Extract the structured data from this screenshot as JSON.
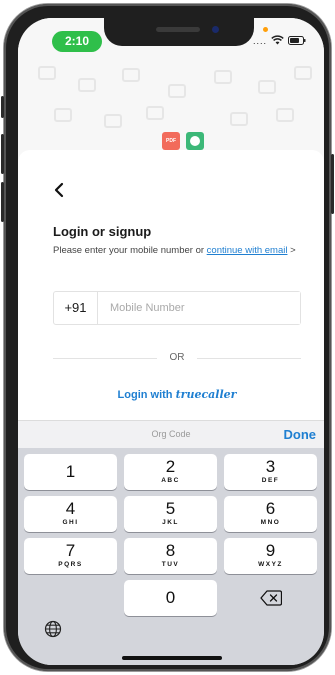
{
  "status_bar": {
    "time": "2:10",
    "signal": "....",
    "wifi_icon": "wifi-icon",
    "battery_icon": "battery-icon"
  },
  "background": {
    "pdf_badge": "PDF"
  },
  "login": {
    "title": "Login or signup",
    "subtitle_text": "Please enter your mobile number or ",
    "subtitle_link": "continue with email",
    "subtitle_suffix": " >",
    "country_code": "+91",
    "phone_placeholder": "Mobile Number",
    "or_label": "OR",
    "truecaller_prefix": "Login with ",
    "truecaller_brand": "truecaller"
  },
  "accessory_bar": {
    "field_hint": "Org Code",
    "done_label": "Done"
  },
  "keypad": {
    "keys": [
      {
        "num": "1",
        "letters": ""
      },
      {
        "num": "2",
        "letters": "ABC"
      },
      {
        "num": "3",
        "letters": "DEF"
      },
      {
        "num": "4",
        "letters": "GHI"
      },
      {
        "num": "5",
        "letters": "JKL"
      },
      {
        "num": "6",
        "letters": "MNO"
      },
      {
        "num": "7",
        "letters": "PQRS"
      },
      {
        "num": "8",
        "letters": "TUV"
      },
      {
        "num": "9",
        "letters": "WXYZ"
      },
      {
        "num": "0",
        "letters": ""
      }
    ]
  }
}
